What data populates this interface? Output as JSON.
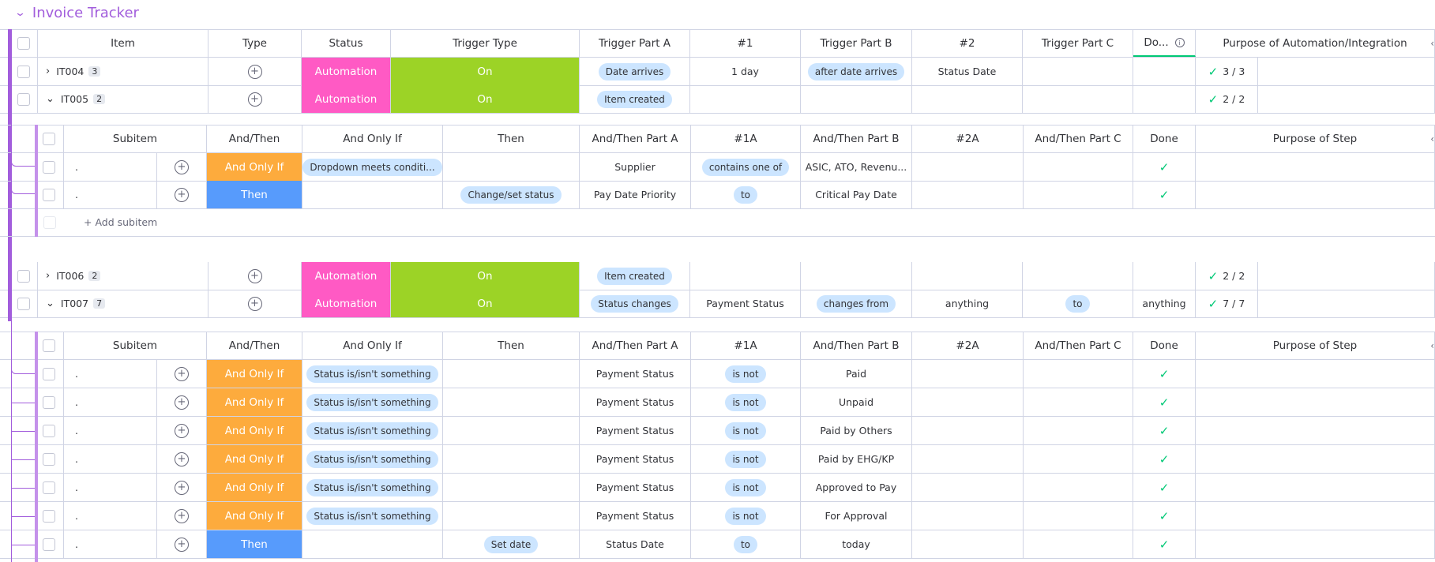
{
  "group": {
    "title": "Invoice Tracker",
    "color": "#a25ddc"
  },
  "main_headers": [
    "Item",
    "Type",
    "Status",
    "Trigger Type",
    "Trigger Part A",
    "#1",
    "Trigger Part B",
    "#2",
    "Trigger Part C",
    "Do...",
    "Purpose of Automation/Integration"
  ],
  "sub_headers": [
    "Subitem",
    "And/Then",
    "And Only If",
    "Then",
    "And/Then Part A",
    "#1A",
    "And/Then Part B",
    "#2A",
    "And/Then Part C",
    "Done",
    "Purpose of Step"
  ],
  "items": [
    {
      "name": "IT004",
      "count": "3",
      "expanded": false,
      "type": "Automation",
      "status": "On",
      "trigger_type": "Date arrives",
      "part_a": "1 day",
      "n1": "after date arrives",
      "part_b": "Status Date",
      "n2": "",
      "part_c": "",
      "done": "3 / 3"
    },
    {
      "name": "IT005",
      "count": "2",
      "expanded": true,
      "type": "Automation",
      "status": "On",
      "trigger_type": "Item created",
      "part_a": "",
      "n1": "",
      "part_b": "",
      "n2": "",
      "part_c": "",
      "done": "2 / 2"
    },
    {
      "name": "IT006",
      "count": "2",
      "expanded": false,
      "type": "Automation",
      "status": "On",
      "trigger_type": "Item created",
      "part_a": "",
      "n1": "",
      "part_b": "",
      "n2": "",
      "part_c": "",
      "done": "2 / 2"
    },
    {
      "name": "IT007",
      "count": "7",
      "expanded": true,
      "type": "Automation",
      "status": "On",
      "trigger_type": "Status changes",
      "part_a": "Payment Status",
      "n1": "changes from",
      "part_b": "anything",
      "n2": "to",
      "part_c": "anything",
      "done": "7 / 7"
    }
  ],
  "subitems_it005": [
    {
      "name": ".",
      "and_then": "And Only If",
      "only_if": "Dropdown meets conditi...",
      "then": "",
      "part_a": "Supplier",
      "n1a": "contains one of",
      "part_b": "ASIC, ATO, Revenu...",
      "n2a": "",
      "part_c": ""
    },
    {
      "name": ".",
      "and_then": "Then",
      "only_if": "",
      "then": "Change/set status",
      "part_a": "Pay Date Priority",
      "n1a": "to",
      "part_b": "Critical Pay Date",
      "n2a": "",
      "part_c": ""
    }
  ],
  "add_subitem_label": "+ Add subitem",
  "subitems_it007": [
    {
      "name": ".",
      "and_then": "And Only If",
      "only_if": "Status is/isn't something",
      "then": "",
      "part_a": "Payment Status",
      "n1a": "is not",
      "part_b": "Paid"
    },
    {
      "name": ".",
      "and_then": "And Only If",
      "only_if": "Status is/isn't something",
      "then": "",
      "part_a": "Payment Status",
      "n1a": "is not",
      "part_b": "Unpaid"
    },
    {
      "name": ".",
      "and_then": "And Only If",
      "only_if": "Status is/isn't something",
      "then": "",
      "part_a": "Payment Status",
      "n1a": "is not",
      "part_b": "Paid by Others"
    },
    {
      "name": ".",
      "and_then": "And Only If",
      "only_if": "Status is/isn't something",
      "then": "",
      "part_a": "Payment Status",
      "n1a": "is not",
      "part_b": "Paid by EHG/KP"
    },
    {
      "name": ".",
      "and_then": "And Only If",
      "only_if": "Status is/isn't something",
      "then": "",
      "part_a": "Payment Status",
      "n1a": "is not",
      "part_b": "Approved to Pay"
    },
    {
      "name": ".",
      "and_then": "And Only If",
      "only_if": "Status is/isn't something",
      "then": "",
      "part_a": "Payment Status",
      "n1a": "is not",
      "part_b": "For Approval"
    },
    {
      "name": ".",
      "and_then": "Then",
      "only_if": "",
      "then": "Set date",
      "part_a": "Status Date",
      "n1a": "to",
      "part_b": "today"
    }
  ],
  "colors": {
    "automation": "#ff5ac4",
    "on": "#9cd326",
    "and_only_if": "#fdab3d",
    "then": "#579bfc",
    "done_check": "#00c875",
    "pill": "#cce5ff"
  }
}
